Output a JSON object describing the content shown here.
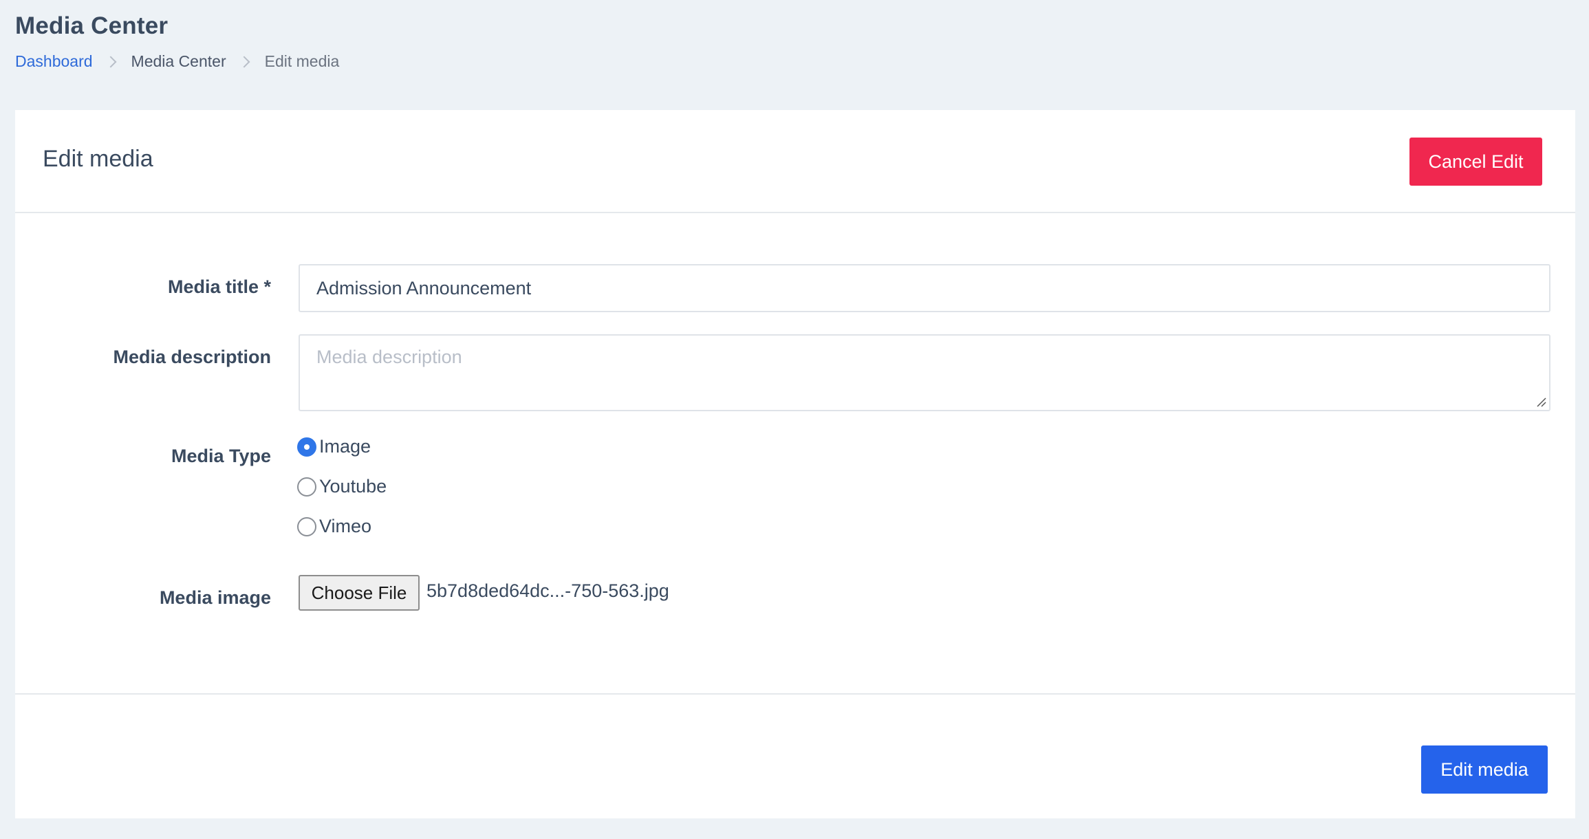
{
  "page": {
    "title": "Media Center",
    "breadcrumb": [
      {
        "label": "Dashboard"
      },
      {
        "label": "Media Center"
      },
      {
        "label": "Edit media"
      }
    ]
  },
  "card": {
    "title": "Edit media",
    "cancel_label": "Cancel Edit",
    "submit_label": "Edit media"
  },
  "form": {
    "title_label": "Media title *",
    "title_value": "Admission Announcement",
    "description_label": "Media description",
    "description_placeholder": "Media description",
    "description_value": "",
    "type_label": "Media Type",
    "type_options": [
      {
        "label": "Image",
        "checked": true
      },
      {
        "label": "Youtube",
        "checked": false
      },
      {
        "label": "Vimeo",
        "checked": false
      }
    ],
    "image_label": "Media image",
    "file_button_label": "Choose File",
    "file_name": "5b7d8ded64dc...-750-563.jpg"
  },
  "colors": {
    "background": "#edf2f6",
    "link": "#2e6ad9",
    "cancel_button": "#f0274f",
    "submit_button": "#2563eb",
    "radio_checked": "#2f76e8"
  },
  "icons": {
    "breadcrumb_separator": "chevron-right-icon"
  }
}
